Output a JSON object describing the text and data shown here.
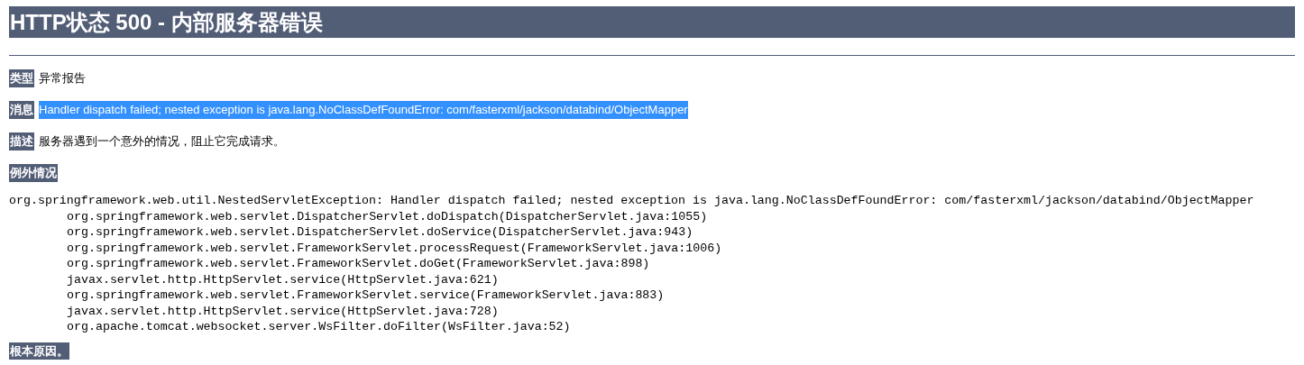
{
  "title": "HTTP状态 500 - 内部服务器错误",
  "fields": [
    {
      "label": "类型",
      "value": "异常报告",
      "highlighted": false
    },
    {
      "label": "消息",
      "value": "Handler dispatch failed; nested exception is java.lang.NoClassDefFoundError: com/fasterxml/jackson/databind/ObjectMapper",
      "highlighted": true
    },
    {
      "label": "描述",
      "value": "服务器遇到一个意外的情况，阻止它完成请求。",
      "highlighted": false
    }
  ],
  "exception": {
    "label": "例外情况",
    "trace": {
      "text": "org.springframework.web.util.NestedServletException: Handler dispatch failed; nested exception is java.lang.NoClassDefFoundError: com/fasterxml/jackson/databind/ObjectMapper",
      "children": [
        {
          "text": "org.springframework.web.servlet.DispatcherServlet.doDispatch(DispatcherServlet.java:1055)"
        },
        {
          "text": "org.springframework.web.servlet.DispatcherServlet.doService(DispatcherServlet.java:943)"
        },
        {
          "text": "org.springframework.web.servlet.FrameworkServlet.processRequest(FrameworkServlet.java:1006)"
        },
        {
          "text": "org.springframework.web.servlet.FrameworkServlet.doGet(FrameworkServlet.java:898)"
        },
        {
          "text": "javax.servlet.http.HttpServlet.service(HttpServlet.java:621)"
        },
        {
          "text": "org.springframework.web.servlet.FrameworkServlet.service(FrameworkServlet.java:883)"
        },
        {
          "text": "javax.servlet.http.HttpServlet.service(HttpServlet.java:728)"
        },
        {
          "text": "org.apache.tomcat.websocket.server.WsFilter.doFilter(WsFilter.java:52)"
        }
      ]
    }
  },
  "root_cause": {
    "label": "根本原因。"
  }
}
